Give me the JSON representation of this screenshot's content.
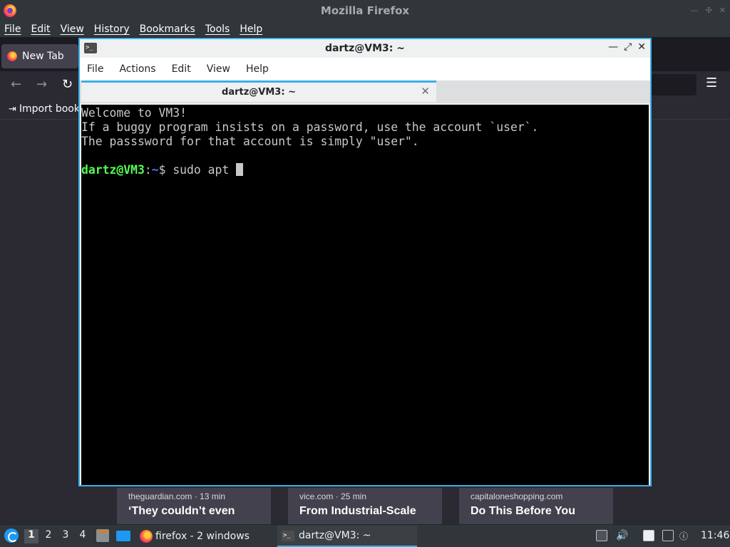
{
  "firefox": {
    "window_title": "Mozilla Firefox",
    "menu": [
      "File",
      "Edit",
      "View",
      "History",
      "Bookmarks",
      "Tools",
      "Help"
    ],
    "tab_label": "New Tab",
    "bookmarks_import": "Import book",
    "news_cards": [
      {
        "source": "theguardian.com · 13 min",
        "headline": "‘They couldn’t even"
      },
      {
        "source": "vice.com · 25 min",
        "headline": "From Industrial-Scale"
      },
      {
        "source": "capitaloneshopping.com",
        "headline": "Do This Before You"
      }
    ]
  },
  "terminal": {
    "window_title": "dartz@VM3: ~",
    "menu": [
      "File",
      "Actions",
      "Edit",
      "View",
      "Help"
    ],
    "tab_label": "dartz@VM3: ~",
    "lines": [
      "Welcome to VM3!",
      "If a buggy program insists on a password, use the account `user`.",
      "The passsword for that account is simply \"user\"."
    ],
    "prompt_user": "dartz@VM3",
    "prompt_sep": ":",
    "prompt_path": "~",
    "prompt_symbol": "$ ",
    "command": "sudo apt "
  },
  "taskbar": {
    "desktops": [
      "1",
      "2",
      "3",
      "4"
    ],
    "active_desktop": "1",
    "tasks": [
      {
        "label": "firefox - 2 windows",
        "icon": "firefox-icon"
      },
      {
        "label": "dartz@VM3: ~",
        "icon": "terminal-icon"
      }
    ],
    "clock": "11:46"
  },
  "colors": {
    "accent": "#3daee9",
    "prompt_user": "#54ff54",
    "prompt_path": "#5476ff"
  }
}
